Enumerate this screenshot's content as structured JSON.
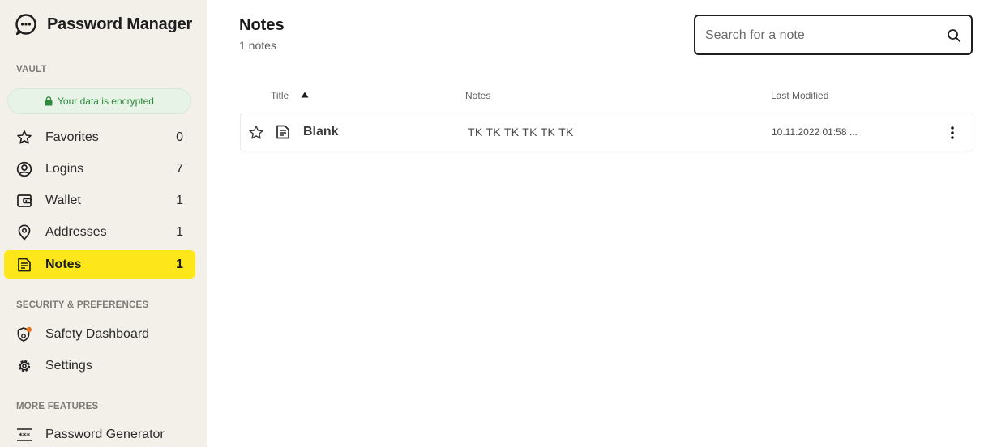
{
  "app": {
    "name": "Password Manager"
  },
  "sidebar": {
    "vault_title": "VAULT",
    "encrypted_text": "Your data is encrypted",
    "vault_items": [
      {
        "label": "Favorites",
        "count": "0",
        "icon": "star-icon"
      },
      {
        "label": "Logins",
        "count": "7",
        "icon": "user-circle-icon"
      },
      {
        "label": "Wallet",
        "count": "1",
        "icon": "wallet-icon"
      },
      {
        "label": "Addresses",
        "count": "1",
        "icon": "location-pin-icon"
      },
      {
        "label": "Notes",
        "count": "1",
        "icon": "note-icon",
        "active": true
      }
    ],
    "security_title": "SECURITY & PREFERENCES",
    "security_items": [
      {
        "label": "Safety Dashboard",
        "icon": "shield-alert-icon"
      },
      {
        "label": "Settings",
        "icon": "gear-icon"
      }
    ],
    "more_title": "MORE FEATURES",
    "more_items": [
      {
        "label": "Password Generator",
        "icon": "password-generator-icon"
      }
    ]
  },
  "main": {
    "title": "Notes",
    "subtitle": "1 notes",
    "search": {
      "placeholder": "Search for a note",
      "value": ""
    },
    "columns": {
      "title": "Title",
      "notes": "Notes",
      "modified": "Last Modified"
    },
    "rows": [
      {
        "title": "Blank",
        "notes": "TK TK TK TK TK TK",
        "modified": "10.11.2022 01:58 ..."
      }
    ]
  },
  "colors": {
    "sidebar_bg": "#f3f0ea",
    "active_highlight": "#fde619",
    "encrypted_green": "#2e8b3c",
    "badge_orange": "#e8731c"
  }
}
